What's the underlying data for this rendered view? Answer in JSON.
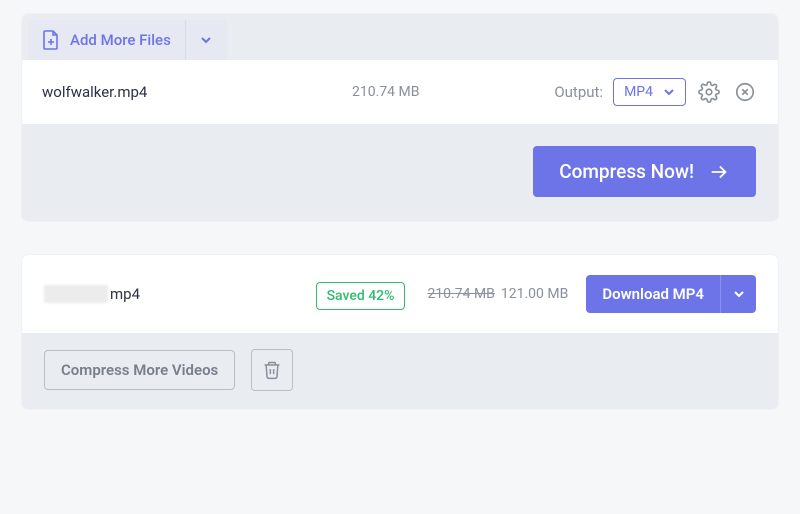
{
  "upload": {
    "add_more_label": "Add More Files",
    "file": {
      "name": "wolfwalker.mp4",
      "size": "210.74 MB"
    },
    "output_label": "Output:",
    "output_format": "MP4",
    "compress_label": "Compress Now!"
  },
  "result": {
    "file_ext": "mp4",
    "saved_label": "Saved 42%",
    "original_size": "210.74 MB",
    "new_size": "121.00 MB",
    "download_label": "Download MP4",
    "compress_more_label": "Compress More Videos"
  },
  "colors": {
    "accent": "#6c74e8",
    "success": "#2fbb6e"
  }
}
